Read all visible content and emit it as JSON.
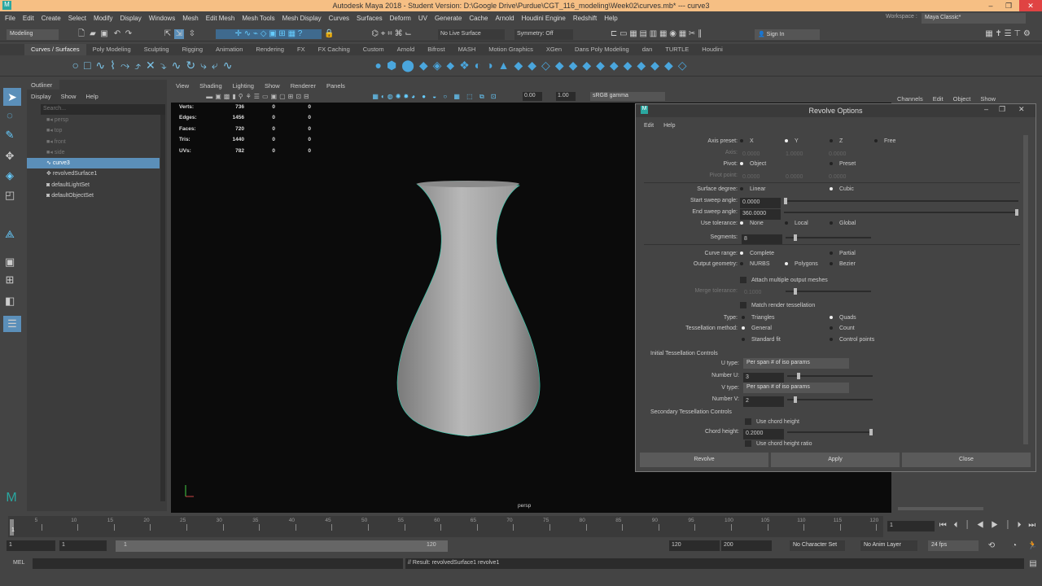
{
  "window": {
    "title": "Autodesk Maya 2018 - Student Version: D:\\Google Drive\\Purdue\\CGT_116_modeling\\Week02\\curves.mb*  ---  curve3",
    "minimize": "–",
    "maximize": "❐",
    "close": "✕"
  },
  "menu": [
    "File",
    "Edit",
    "Create",
    "Select",
    "Modify",
    "Display",
    "Windows",
    "Mesh",
    "Edit Mesh",
    "Mesh Tools",
    "Mesh Display",
    "Curves",
    "Surfaces",
    "Deform",
    "UV",
    "Generate",
    "Cache",
    "Arnold",
    "Houdini Engine",
    "Redshift",
    "Help"
  ],
  "workspace": {
    "label": "Workspace :",
    "value": "Maya Classic*"
  },
  "status": {
    "mode": "Modeling",
    "live_surface": "No Live Surface",
    "symmetry": "Symmetry: Off",
    "sign_in": "Sign In"
  },
  "shelf_tabs": [
    "Curves / Surfaces",
    "Poly Modeling",
    "Sculpting",
    "Rigging",
    "Animation",
    "Rendering",
    "FX",
    "FX Caching",
    "Custom",
    "Arnold",
    "Bifrost",
    "MASH",
    "Motion Graphics",
    "XGen",
    "Dans Poly Modeling",
    "dan",
    "TURTLE",
    "Houdini"
  ],
  "outliner": {
    "title": "Outliner",
    "menu": [
      "Display",
      "Show",
      "Help"
    ],
    "search_placeholder": "Search...",
    "items": [
      {
        "name": "persp",
        "dim": true
      },
      {
        "name": "top",
        "dim": true
      },
      {
        "name": "front",
        "dim": true
      },
      {
        "name": "side",
        "dim": true
      },
      {
        "name": "curve3",
        "selected": true
      },
      {
        "name": "revolvedSurface1"
      },
      {
        "name": "defaultLightSet"
      },
      {
        "name": "defaultObjectSet"
      }
    ]
  },
  "viewport": {
    "menu": [
      "View",
      "Shading",
      "Lighting",
      "Show",
      "Renderer",
      "Panels"
    ],
    "exposure": "0.00",
    "gamma": "1.00",
    "color_space": "sRGB gamma",
    "camera": "persp",
    "hud": [
      {
        "label": "Verts:",
        "v": [
          "736",
          "0",
          "0"
        ]
      },
      {
        "label": "Edges:",
        "v": [
          "1456",
          "0",
          "0"
        ]
      },
      {
        "label": "Faces:",
        "v": [
          "720",
          "0",
          "0"
        ]
      },
      {
        "label": "Tris:",
        "v": [
          "1440",
          "0",
          "0"
        ]
      },
      {
        "label": "UVs:",
        "v": [
          "782",
          "0",
          "0"
        ]
      }
    ]
  },
  "channel_box": {
    "menu": [
      "Channels",
      "Edit",
      "Object",
      "Show"
    ]
  },
  "dialog": {
    "title": "Revolve Options",
    "menu": [
      "Edit",
      "Help"
    ],
    "axis_preset": "Axis preset:",
    "x": "X",
    "y": "Y",
    "z": "Z",
    "free": "Free",
    "axis": "Axis:",
    "axis_vals": [
      "0.0000",
      "1.0000",
      "0.0000"
    ],
    "pivot": "Pivot:",
    "object": "Object",
    "preset": "Preset",
    "pivot_point": "Pivot point:",
    "pivot_vals": [
      "0.0000",
      "0.0000",
      "0.0000"
    ],
    "surface_degree": "Surface degree:",
    "linear": "Linear",
    "cubic": "Cubic",
    "start_sweep": "Start sweep angle:",
    "start_sweep_val": "0.0000",
    "end_sweep": "End sweep angle:",
    "end_sweep_val": "360.0000",
    "use_tol": "Use tolerance:",
    "none": "None",
    "local": "Local",
    "global": "Global",
    "segments": "Segments:",
    "segments_val": "8",
    "curve_range": "Curve range:",
    "complete": "Complete",
    "partial": "Partial",
    "output_geom": "Output geometry:",
    "nurbs": "NURBS",
    "polygons": "Polygons",
    "bezier": "Bezier",
    "attach_multi": "Attach multiple output meshes",
    "merge_tol": "Merge tolerance:",
    "merge_tol_val": "0.1000",
    "match_render": "Match render tessellation",
    "type": "Type:",
    "triangles": "Triangles",
    "quads": "Quads",
    "tess_method": "Tessellation method:",
    "general": "General",
    "count": "Count",
    "standard_fit": "Standard fit",
    "control_points": "Control points",
    "initial_tess": "Initial Tessellation Controls",
    "u_type": "U type:",
    "u_type_val": "Per span # of iso params",
    "number_u": "Number U:",
    "number_u_val": "3",
    "v_type": "V type:",
    "v_type_val": "Per span # of iso params",
    "number_v": "Number V:",
    "number_v_val": "2",
    "secondary_tess": "Secondary Tessellation Controls",
    "use_chord": "Use chord height",
    "chord_height": "Chord height:",
    "chord_height_val": "0.2000",
    "use_chord_ratio": "Use chord height ratio",
    "revolve": "Revolve",
    "apply": "Apply",
    "close": "Close"
  },
  "timeline": {
    "ticks": [
      "5",
      "10",
      "15",
      "20",
      "25",
      "30",
      "35",
      "40",
      "45",
      "50",
      "55",
      "60",
      "65",
      "70",
      "75",
      "80",
      "85",
      "90",
      "95",
      "100",
      "105",
      "110",
      "115",
      "120"
    ],
    "start_marker": "1",
    "current_frame": "1",
    "range_start": "1",
    "playback_start": "1",
    "slider_start": "1",
    "slider_end": "120",
    "playback_end": "120",
    "range_end": "200",
    "character_set": "No Character Set",
    "anim_layer": "No Anim Layer",
    "fps": "24 fps"
  },
  "command": {
    "lang": "MEL",
    "result": "// Result: revolvedSurface1 revolve1"
  }
}
